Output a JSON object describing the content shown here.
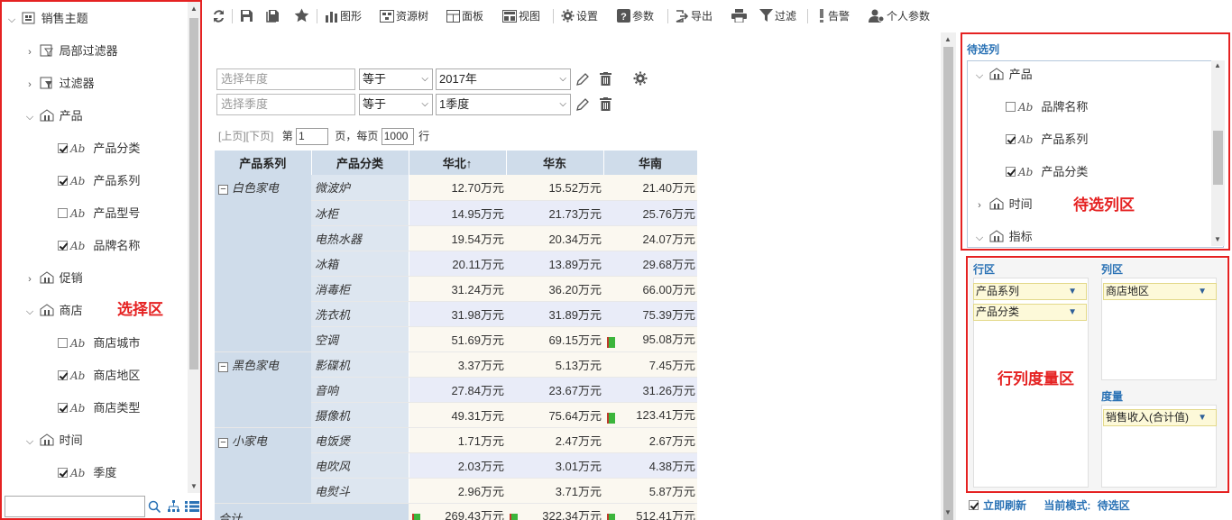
{
  "selection_panel": {
    "zone_label": "选择区",
    "search_placeholder": "",
    "tree": {
      "root": "销售主题",
      "local_filter": "局部过滤器",
      "filter": "过滤器",
      "product": "产品",
      "product_children": [
        {
          "label": "产品分类",
          "checked": true
        },
        {
          "label": "产品系列",
          "checked": true
        },
        {
          "label": "产品型号",
          "checked": false
        },
        {
          "label": "品牌名称",
          "checked": true
        }
      ],
      "promotion": "促销",
      "store": "商店",
      "store_children": [
        {
          "label": "商店城市",
          "checked": false
        },
        {
          "label": "商店地区",
          "checked": true
        },
        {
          "label": "商店类型",
          "checked": true
        }
      ],
      "time": "时间",
      "time_children": [
        {
          "label": "季度",
          "checked": true
        }
      ]
    }
  },
  "toolbar": {
    "chart": "图形",
    "resource_tree": "资源树",
    "panel": "面板",
    "view": "视图",
    "settings": "设置",
    "params": "参数",
    "export": "导出",
    "filter": "过滤",
    "alert": "告警",
    "personal_params": "个人参数"
  },
  "filters": [
    {
      "placeholder": "选择年度",
      "operator": "等于",
      "value": "2017年"
    },
    {
      "placeholder": "选择季度",
      "operator": "等于",
      "value": "1季度"
    }
  ],
  "pager": {
    "prev": "[上页]",
    "next": "[下页]",
    "page_prefix": "第",
    "page_value": "1",
    "page_suffix": "页，每页",
    "per_page": "1000",
    "rows_suffix": "行"
  },
  "table": {
    "headers": [
      "产品系列",
      "产品分类",
      "华北↑",
      "华东",
      "华南"
    ],
    "groups": [
      {
        "series": "白色家电",
        "rows": [
          {
            "cat": "微波炉",
            "v": [
              "12.70万元",
              "15.52万元",
              "21.40万元"
            ],
            "flag": false
          },
          {
            "cat": "冰柜",
            "v": [
              "14.95万元",
              "21.73万元",
              "25.76万元"
            ],
            "flag": false
          },
          {
            "cat": "电热水器",
            "v": [
              "19.54万元",
              "20.34万元",
              "24.07万元"
            ],
            "flag": false
          },
          {
            "cat": "冰箱",
            "v": [
              "20.11万元",
              "13.89万元",
              "29.68万元"
            ],
            "flag": false
          },
          {
            "cat": "消毒柜",
            "v": [
              "31.24万元",
              "36.20万元",
              "66.00万元"
            ],
            "flag": false
          },
          {
            "cat": "洗衣机",
            "v": [
              "31.98万元",
              "31.89万元",
              "75.39万元"
            ],
            "flag": false
          },
          {
            "cat": "空调",
            "v": [
              "51.69万元",
              "69.15万元",
              "95.08万元"
            ],
            "flag": true
          }
        ]
      },
      {
        "series": "黑色家电",
        "rows": [
          {
            "cat": "影碟机",
            "v": [
              "3.37万元",
              "5.13万元",
              "7.45万元"
            ],
            "flag": false
          },
          {
            "cat": "音响",
            "v": [
              "27.84万元",
              "23.67万元",
              "31.26万元"
            ],
            "flag": false
          },
          {
            "cat": "摄像机",
            "v": [
              "49.31万元",
              "75.64万元",
              "123.41万元"
            ],
            "flag": true
          }
        ]
      },
      {
        "series": "小家电",
        "rows": [
          {
            "cat": "电饭煲",
            "v": [
              "1.71万元",
              "2.47万元",
              "2.67万元"
            ],
            "flag": false
          },
          {
            "cat": "电吹风",
            "v": [
              "2.03万元",
              "3.01万元",
              "4.38万元"
            ],
            "flag": false
          },
          {
            "cat": "电熨斗",
            "v": [
              "2.96万元",
              "3.71万元",
              "5.87万元"
            ],
            "flag": false
          }
        ]
      }
    ],
    "total": {
      "label": "合计",
      "v": [
        "269.43万元",
        "322.34万元",
        "512.41万元"
      ]
    }
  },
  "candidate_panel": {
    "title": "待选列",
    "zone_label": "待选列区",
    "product": "产品",
    "product_children": [
      {
        "label": "品牌名称",
        "checked": false
      },
      {
        "label": "产品系列",
        "checked": true
      },
      {
        "label": "产品分类",
        "checked": true
      }
    ],
    "time": "时间",
    "measures": "指标"
  },
  "layout_panel": {
    "zone_label": "行列度量区",
    "row_area_title": "行区",
    "col_area_title": "列区",
    "measure_title": "度量",
    "row_fields": [
      "产品系列",
      "产品分类"
    ],
    "col_fields": [
      "商店地区"
    ],
    "measure_fields": [
      "销售收入(合计值)"
    ]
  },
  "bottom_bar": {
    "auto_refresh": "立即刷新",
    "mode_label": "当前模式:",
    "mode_value": "待选区"
  },
  "colors": {
    "accent_red": "#e52222",
    "header_blue": "#cfdcea",
    "link_blue": "#2a72b5",
    "chip_yellow": "#fdf9d9"
  }
}
